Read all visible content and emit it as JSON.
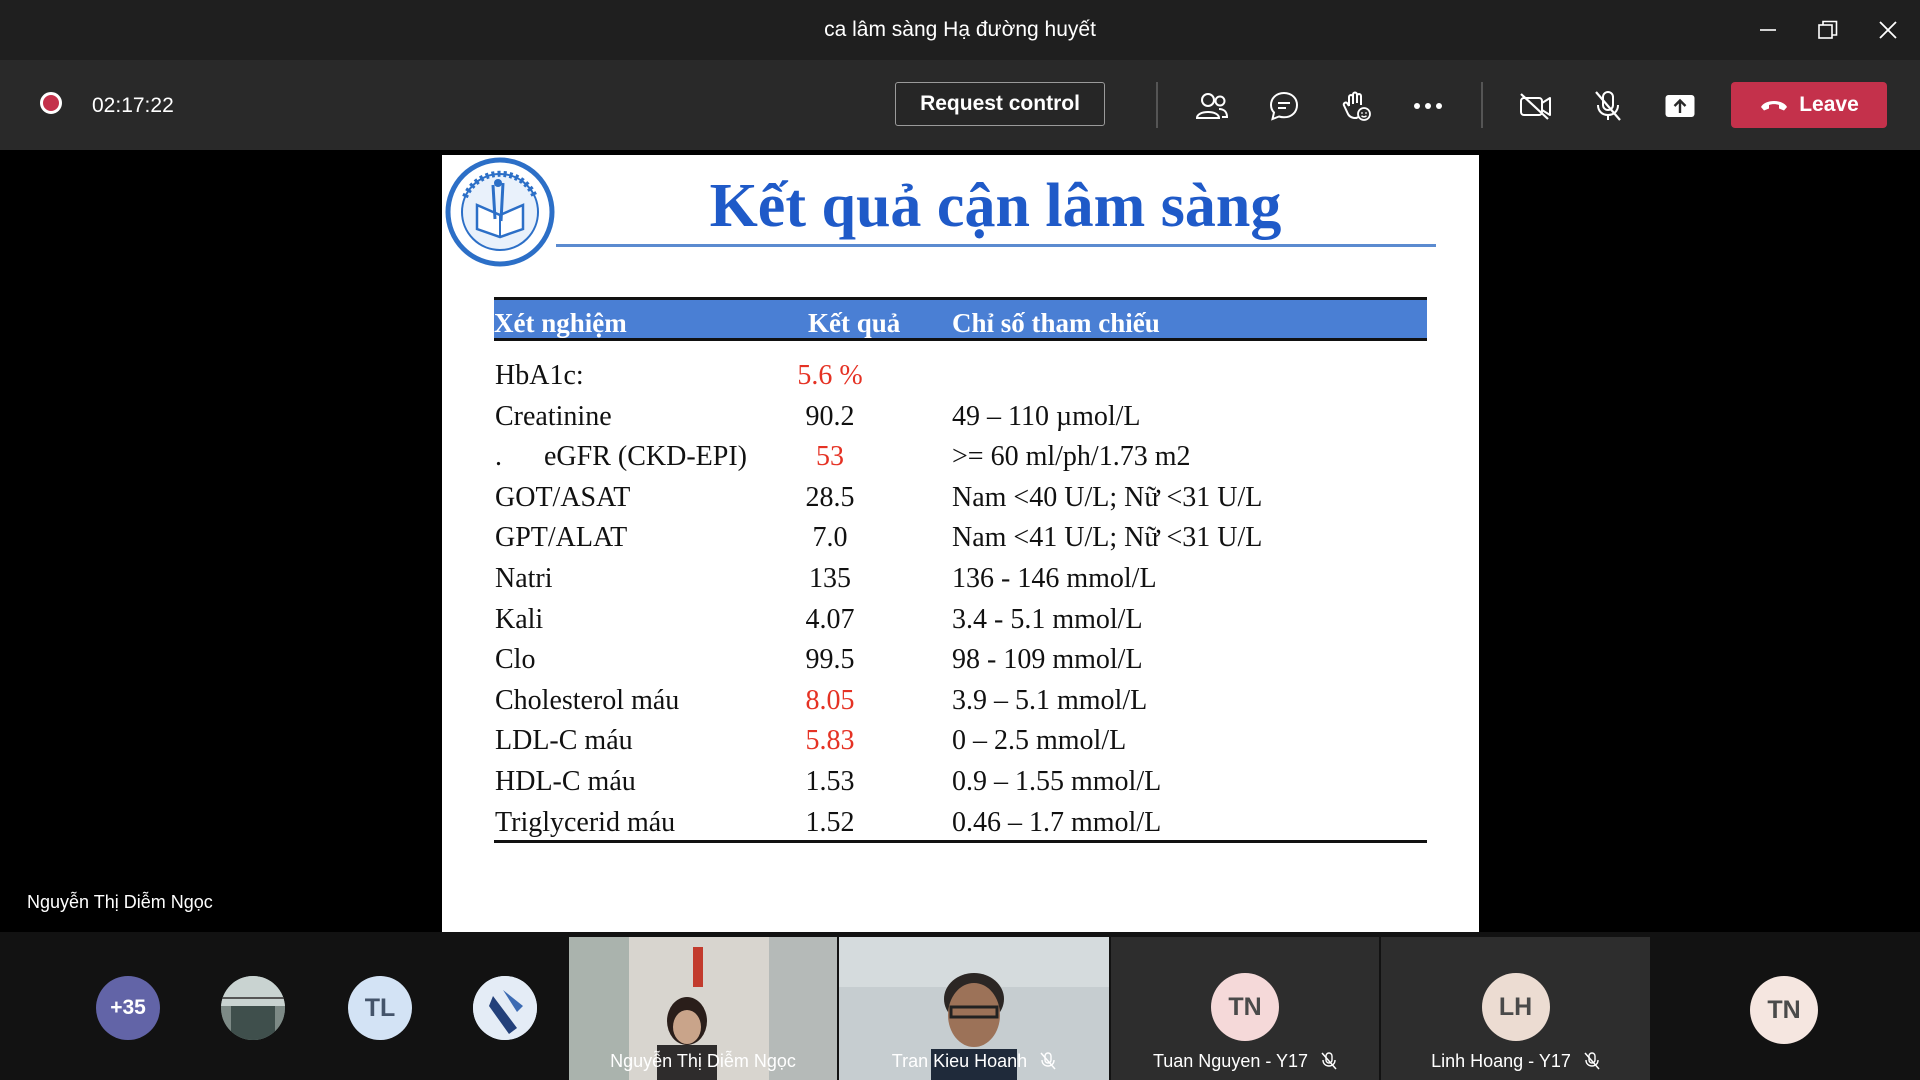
{
  "window": {
    "title": "ca lâm sàng Hạ đường huyết"
  },
  "toolbar": {
    "recording_time": "02:17:22",
    "request_control_label": "Request control",
    "leave_label": "Leave",
    "icons": [
      "participants-icon",
      "chat-icon",
      "raise-hand-icon",
      "more-options-icon",
      "camera-off-icon",
      "mic-off-icon",
      "share-screen-icon",
      "hang-up-icon"
    ]
  },
  "slide": {
    "title": "Kết quả cận lâm sàng",
    "headers": [
      "Xét nghiệm",
      "Kết quả",
      "Chỉ số tham chiếu"
    ],
    "rows": [
      {
        "name": "HbA1c:",
        "value": "5.6 %",
        "ref": "",
        "abnormal": true
      },
      {
        "name": "Creatinine",
        "value": "90.2",
        "ref": "49 – 110 µmol/L",
        "abnormal": false
      },
      {
        "name": ".      eGFR (CKD-EPI)",
        "value": "53",
        "ref": ">= 60 ml/ph/1.73 m2",
        "abnormal": true
      },
      {
        "name": "GOT/ASAT",
        "value": "28.5",
        "ref": "Nam <40 U/L; Nữ  <31 U/L",
        "abnormal": false
      },
      {
        "name": "GPT/ALAT",
        "value": "7.0",
        "ref": "Nam <41 U/L; Nữ  <31 U/L",
        "abnormal": false
      },
      {
        "name": "Natri",
        "value": "135",
        "ref": "136 - 146 mmol/L",
        "abnormal": false
      },
      {
        "name": "Kali",
        "value": "4.07",
        "ref": "3.4 - 5.1 mmol/L",
        "abnormal": false
      },
      {
        "name": "Clo",
        "value": "99.5",
        "ref": "98 - 109 mmol/L",
        "abnormal": false
      },
      {
        "name": "Cholesterol máu",
        "value": "8.05",
        "ref": "3.9 – 5.1 mmol/L",
        "abnormal": true
      },
      {
        "name": "LDL-C máu",
        "value": "5.83",
        "ref": "0 – 2.5 mmol/L",
        "abnormal": true
      },
      {
        "name": "HDL-C máu",
        "value": "1.53",
        "ref": "0.9 – 1.55 mmol/L",
        "abnormal": false
      },
      {
        "name": "Triglycerid máu",
        "value": "1.52",
        "ref": "0.46 – 1.7 mmol/L",
        "abnormal": false
      }
    ]
  },
  "stage": {
    "presenter_name": "Nguyễn Thị Diễm Ngọc"
  },
  "gallery": {
    "overflow_count": "+35",
    "avatars": [
      "TL"
    ],
    "tiles": [
      {
        "name": "Nguyễn Thị Diễm Ngọc",
        "type": "video"
      },
      {
        "name": "Tran Kieu Hoanh",
        "type": "video"
      },
      {
        "name": "Tuan Nguyen - Y17",
        "initials": "TN"
      },
      {
        "name": "Linh Hoang - Y17",
        "initials": "LH"
      },
      {
        "name": "",
        "initials": "TN"
      }
    ]
  },
  "colors": {
    "accent": "#c4314b",
    "abnormal": "#e53224",
    "slide_title": "#1f5ac8",
    "table_header": "#4a7fd4",
    "avatar_circle": "#6264a7"
  }
}
